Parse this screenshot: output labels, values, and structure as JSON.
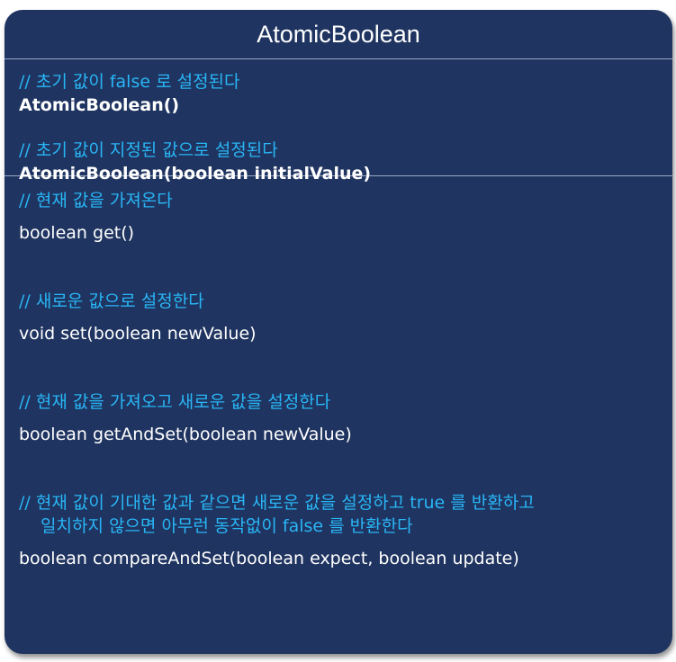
{
  "title": "AtomicBoolean",
  "constructors": [
    {
      "comment": "// 초기 값이 false 로 설정된다",
      "signature": "AtomicBoolean()"
    },
    {
      "comment": "// 초기 값이 지정된 값으로 설정된다",
      "signature": "AtomicBoolean(boolean initialValue)"
    }
  ],
  "methods": [
    {
      "comment": "// 현재 값을 가져온다",
      "signature": "boolean get()"
    },
    {
      "comment": "// 새로운 값으로 설정한다",
      "signature": "void set(boolean newValue)"
    },
    {
      "comment": "// 현재 값을 가져오고 새로운 값을 설정한다",
      "signature": "boolean getAndSet(boolean newValue)"
    },
    {
      "comment": "// 현재 값이 기대한 값과 같으면 새로운 값을 설정하고 true 를 반환하고",
      "comment_cont": "일치하지 않으면 아무런 동작없이 false 를 반환한다",
      "signature": "boolean compareAndSet(boolean expect, boolean update)"
    }
  ]
}
